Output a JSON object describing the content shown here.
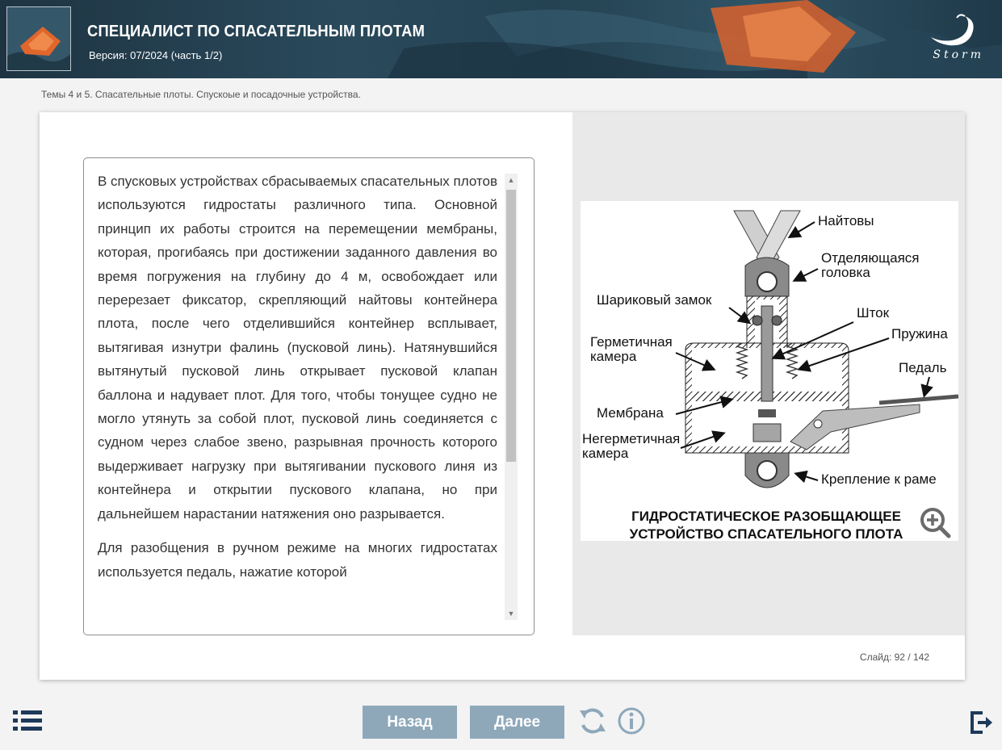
{
  "header": {
    "title": "СПЕЦИАЛИСТ ПО СПАСАТЕЛЬНЫМ ПЛОТАМ",
    "version": "Версия: 07/2024 (часть 1/2)",
    "logo_text": "Storm"
  },
  "breadcrumb": "Темы 4 и 5. Спасательные плоты. Спускоые и посадочные устройства.",
  "content": {
    "paragraphs": [
      "В спусковых устройствах сбрасываемых спасательных плотов используются гидростаты различного типа. Основной принцип их работы строится на перемещении мембраны, которая, прогибаясь при достижении заданного давления во время погружения на глубину до 4 м, освобождает или перерезает фиксатор, скрепляющий найтовы контейнера плота, после чего отделившийся контейнер всплывает, вытягивая изнутри фалинь (пусковой линь). Натянувшийся вытянутый пусковой линь открывает пусковой клапан баллона и надувает плот. Для того, чтобы тонущее судно не могло утянуть за собой плот, пусковой линь соединяется с судном через слабое звено, разрывная прочность которого выдерживает нагрузку при вытягивании пускового линя из контейнера и открытии пускового клапана, но при дальнейшем нарастании натяжения оно разрывается.",
      "Для разобщения в ручном режиме на многих гидростатах используется педаль, нажатие которой"
    ]
  },
  "figure": {
    "labels": {
      "lashings": "Найтовы",
      "release_head_1": "Отделяющаяся",
      "release_head_2": "головка",
      "ball_lock": "Шариковый замок",
      "rod": "Шток",
      "spring": "Пружина",
      "sealed_1": "Герметичная",
      "sealed_2": "камера",
      "pedal": "Педаль",
      "membrane": "Мембрана",
      "unsealed_1": "Негерметичная",
      "unsealed_2": "камера",
      "frame_mount": "Крепление к раме"
    },
    "caption_1": "ГИДРОСТАТИЧЕСКОЕ РАЗОБЩАЮЩЕЕ",
    "caption_2": "УСТРОЙСТВО СПАСАТЕЛЬНОГО ПЛОТА",
    "zoom_icon": "zoom-in-icon"
  },
  "slide_counter": "Слайд:  92 / 142",
  "nav": {
    "back": "Назад",
    "next": "Далее",
    "menu_icon": "list-menu-icon",
    "reload_icon": "refresh-icon",
    "info_icon": "info-icon",
    "exit_icon": "exit-icon"
  },
  "colors": {
    "nav_button": "#8ea8ba",
    "nav_icon": "#1d3a5a",
    "raft_orange": "#e0662c"
  }
}
